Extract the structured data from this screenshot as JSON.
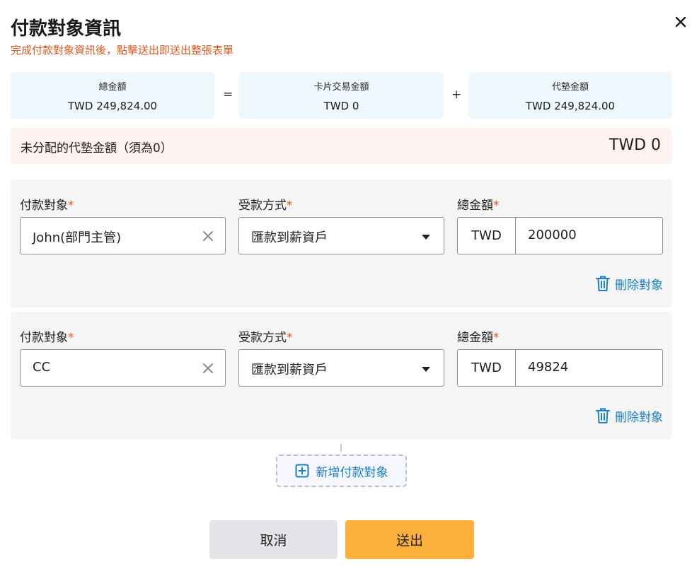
{
  "dialog": {
    "title": "付款對象資訊",
    "subtitle": "完成付款對象資訊後，點擊送出即送出整張表單"
  },
  "summary": {
    "total_label": "總金額",
    "total_value": "TWD 249,824.00",
    "equals": "=",
    "card_label": "卡片交易金額",
    "card_value": "TWD 0",
    "plus": "+",
    "advance_label": "代墊金額",
    "advance_value": "TWD 249,824.00"
  },
  "unallocated": {
    "label": "未分配的代墊金額（須為0）",
    "value": "TWD 0"
  },
  "payees": [
    {
      "payee_label": "付款對象",
      "payee_value": "John(部門主管)",
      "method_label": "受款方式",
      "method_value": "匯款到薪資戶",
      "amount_label": "總金額",
      "currency": "TWD",
      "amount_value": "200000",
      "delete_label": "刪除對象"
    },
    {
      "payee_label": "付款對象",
      "payee_value": "CC",
      "method_label": "受款方式",
      "method_value": "匯款到薪資戶",
      "amount_label": "總金額",
      "currency": "TWD",
      "amount_value": "49824",
      "delete_label": "刪除對象"
    }
  ],
  "required_mark": "*",
  "add_payee_label": "新增付款對象",
  "actions": {
    "cancel_label": "取消",
    "submit_label": "送出"
  },
  "colors": {
    "accent_orange": "#e0561f",
    "link_blue": "#1a7ec8",
    "submit_bg": "#fdb03c",
    "summary_bg": "#eef7fc",
    "warning_bg": "#fdf2f0"
  },
  "icons": [
    "close-icon",
    "clear-icon",
    "chevron-down-icon",
    "trash-icon",
    "plus-square-icon"
  ]
}
